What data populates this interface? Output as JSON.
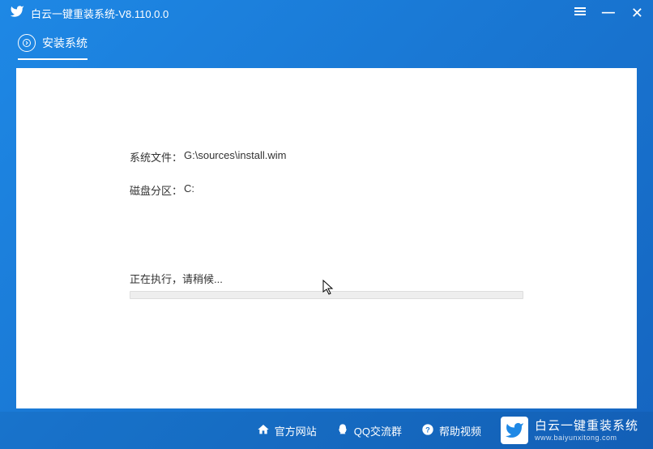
{
  "app": {
    "title": "白云一键重装系统-V8.110.0.0"
  },
  "tab": {
    "label": "安装系统"
  },
  "info": {
    "system_file_label": "系统文件：",
    "system_file_value": "G:\\sources\\install.wim",
    "disk_label": "磁盘分区：",
    "disk_value": "C:"
  },
  "progress": {
    "text": "正在执行，请稍候..."
  },
  "footer": {
    "website": "官方网站",
    "qq": "QQ交流群",
    "help": "帮助视频",
    "brand_main": "白云一键重装系统",
    "brand_sub": "www.baiyunxitong.com"
  }
}
